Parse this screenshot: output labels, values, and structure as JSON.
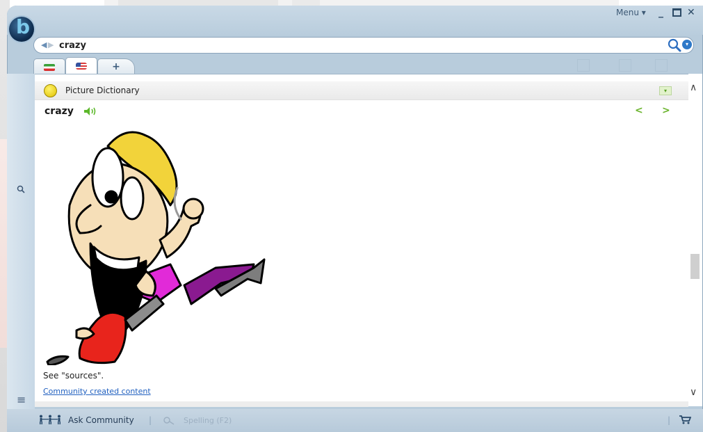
{
  "window": {
    "menu_label": "Menu ▾",
    "minimize_glyph": "_",
    "close_glyph": "✕",
    "logo_letter": "b"
  },
  "search": {
    "back_glyph": "◀",
    "forward_glyph": "▶",
    "query": "crazy",
    "dropdown_glyph": "▾"
  },
  "tabs": [
    {
      "flag": "iran-flag-icon"
    },
    {
      "flag": "us-flag-icon",
      "active": true
    },
    {
      "label": "+"
    }
  ],
  "section": {
    "title": "Picture Dictionary",
    "collapse_glyph": "▾"
  },
  "entry": {
    "word": "crazy",
    "prev_glyph": "<",
    "next_glyph": ">",
    "image": "crazy-cartoon-man-running",
    "sources_text": "See \"sources\".",
    "community_link": "Community created content"
  },
  "scrollbar": {
    "up_glyph": "∧",
    "down_glyph": "∨",
    "position": 0.6
  },
  "rail": {
    "list_glyph": "≡"
  },
  "status": {
    "community_glyph": "🚶",
    "ask_community": "Ask Community",
    "separator": "|",
    "spelling_glyph": "ℙ",
    "spelling": "Spelling (F2)",
    "cart_glyph": "🛒"
  },
  "colors": {
    "chrome": "#b8ccdc",
    "accent_green": "#6ab42c",
    "link_blue": "#1f5fbf"
  }
}
